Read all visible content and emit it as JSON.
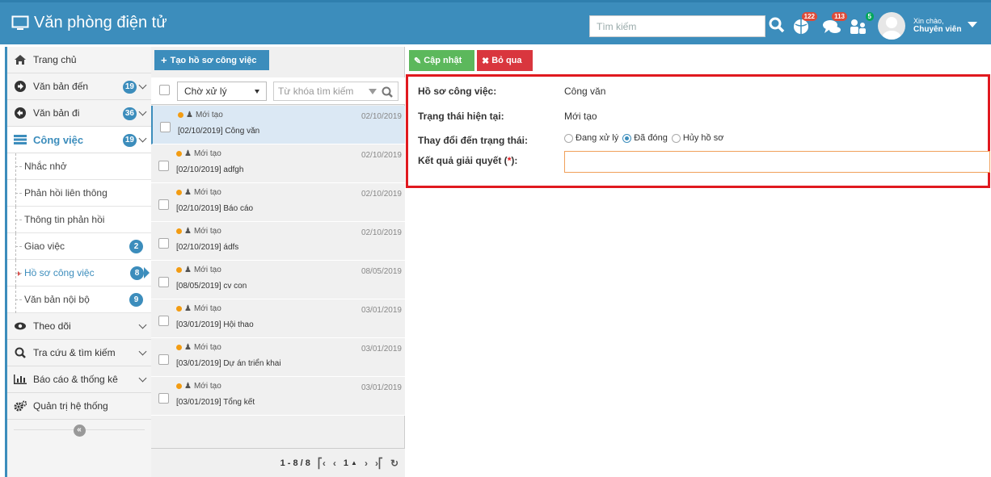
{
  "app": {
    "title": "Văn phòng điện tử"
  },
  "header": {
    "search_placeholder": "Tìm kiếm",
    "notif1_count": "122",
    "notif2_count": "113",
    "notif3_count": "5",
    "greeting": "Xin chào,",
    "user_role": "Chuyên viên"
  },
  "sidebar": {
    "home": "Trang chủ",
    "incoming": "Văn bản đến",
    "incoming_count": "19",
    "outgoing": "Văn bản đi",
    "outgoing_count": "36",
    "work": "Công việc",
    "work_count": "19",
    "sub": {
      "reminders": "Nhắc nhở",
      "linked_feedback": "Phản hồi liên thông",
      "feedback_info": "Thông tin phản hồi",
      "assign": "Giao việc",
      "assign_count": "2",
      "work_files": "Hồ sơ công việc",
      "work_files_count": "8",
      "internal_docs": "Văn bản nội bộ",
      "internal_docs_count": "9"
    },
    "follow": "Theo dõi",
    "lookup": "Tra cứu & tìm kiếm",
    "reports": "Báo cáo & thống kê",
    "admin": "Quản trị hệ thống",
    "collapse_symbol": "«"
  },
  "list": {
    "create_label": "Tạo hồ sơ công việc",
    "status_filter": "Chờ xử lý",
    "keyword_placeholder": "Từ khóa tìm kiếm",
    "items": [
      {
        "status": "Mới tạo",
        "title": "[02/10/2019] Công văn",
        "date": "02/10/2019"
      },
      {
        "status": "Mới tạo",
        "title": "[02/10/2019] adfgh",
        "date": "02/10/2019"
      },
      {
        "status": "Mới tạo",
        "title": "[02/10/2019] Báo cáo",
        "date": "02/10/2019"
      },
      {
        "status": "Mới tạo",
        "title": "[02/10/2019] ádfs",
        "date": "02/10/2019"
      },
      {
        "status": "Mới tạo",
        "title": "[08/05/2019] cv con",
        "date": "08/05/2019"
      },
      {
        "status": "Mới tạo",
        "title": "[03/01/2019] Hội thao",
        "date": "03/01/2019"
      },
      {
        "status": "Mới tạo",
        "title": "[03/01/2019] Dự án triển khai",
        "date": "03/01/2019"
      },
      {
        "status": "Mới tạo",
        "title": "[03/01/2019] Tổng kết",
        "date": "03/01/2019"
      }
    ],
    "pager_range": "1 - 8 / 8",
    "current_page": "1"
  },
  "detail": {
    "update_label": "Cập nhật",
    "skip_label": "Bỏ qua",
    "file_label": "Hồ sơ công việc:",
    "file_value": "Công văn",
    "status_label": "Trạng thái hiện tại:",
    "status_value": "Mới tạo",
    "change_label": "Thay đổi đến trạng thái:",
    "options": [
      "Đang xử lý",
      "Đã đóng",
      "Hủy hồ sơ"
    ],
    "selected_option": "Đã đóng",
    "result_label": "Kết quả giải quyết (",
    "result_req": "*",
    "result_label_end": "):",
    "result_value": ""
  }
}
